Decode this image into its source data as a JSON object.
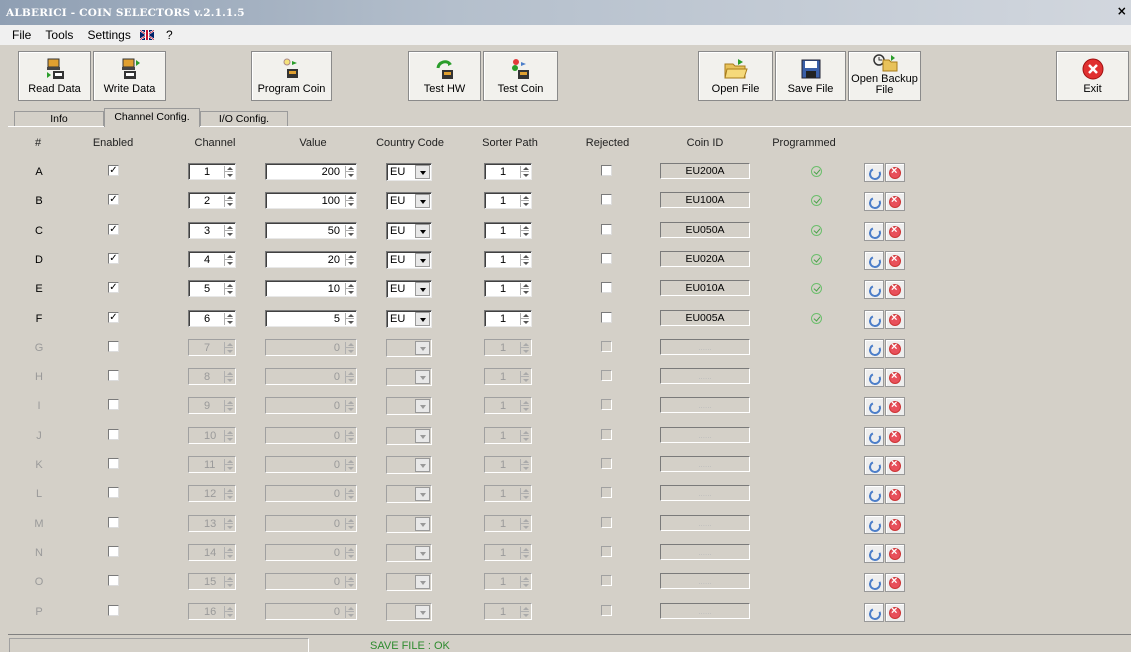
{
  "window": {
    "title": "ALBERICI - COIN SELECTORS v.2.1.1.5",
    "close_glyph": "×"
  },
  "menu": [
    "File",
    "Tools",
    "Settings",
    "?"
  ],
  "toolbar": {
    "read_data": "Read Data",
    "write_data": "Write Data",
    "program_coin": "Program Coin",
    "test_hw": "Test HW",
    "test_coin": "Test Coin",
    "open_file": "Open File",
    "save_file": "Save File",
    "open_backup_1": "Open Backup",
    "open_backup_2": "File",
    "exit": "Exit"
  },
  "tabs": [
    "Info",
    "Channel Config.",
    "I/O Config."
  ],
  "headers": {
    "num": "#",
    "enabled": "Enabled",
    "channel": "Channel",
    "value": "Value",
    "country": "Country Code",
    "sorter": "Sorter Path",
    "rejected": "Rejected",
    "coin_id": "Coin ID",
    "programmed": "Programmed"
  },
  "rows": [
    {
      "letter": "A",
      "enabled": true,
      "channel": "1",
      "value": "200",
      "country": "EU",
      "sorter": "1",
      "coin_id": "EU200A",
      "programmed": true
    },
    {
      "letter": "B",
      "enabled": true,
      "channel": "2",
      "value": "100",
      "country": "EU",
      "sorter": "1",
      "coin_id": "EU100A",
      "programmed": true
    },
    {
      "letter": "C",
      "enabled": true,
      "channel": "3",
      "value": "50",
      "country": "EU",
      "sorter": "1",
      "coin_id": "EU050A",
      "programmed": true
    },
    {
      "letter": "D",
      "enabled": true,
      "channel": "4",
      "value": "20",
      "country": "EU",
      "sorter": "1",
      "coin_id": "EU020A",
      "programmed": true
    },
    {
      "letter": "E",
      "enabled": true,
      "channel": "5",
      "value": "10",
      "country": "EU",
      "sorter": "1",
      "coin_id": "EU010A",
      "programmed": true
    },
    {
      "letter": "F",
      "enabled": true,
      "channel": "6",
      "value": "5",
      "country": "EU",
      "sorter": "1",
      "coin_id": "EU005A",
      "programmed": true
    },
    {
      "letter": "G",
      "enabled": false,
      "channel": "7",
      "value": "0",
      "country": "",
      "sorter": "1",
      "coin_id": "......",
      "programmed": false
    },
    {
      "letter": "H",
      "enabled": false,
      "channel": "8",
      "value": "0",
      "country": "",
      "sorter": "1",
      "coin_id": "......",
      "programmed": false
    },
    {
      "letter": "I",
      "enabled": false,
      "channel": "9",
      "value": "0",
      "country": "",
      "sorter": "1",
      "coin_id": "......",
      "programmed": false
    },
    {
      "letter": "J",
      "enabled": false,
      "channel": "10",
      "value": "0",
      "country": "",
      "sorter": "1",
      "coin_id": "......",
      "programmed": false
    },
    {
      "letter": "K",
      "enabled": false,
      "channel": "11",
      "value": "0",
      "country": "",
      "sorter": "1",
      "coin_id": "......",
      "programmed": false
    },
    {
      "letter": "L",
      "enabled": false,
      "channel": "12",
      "value": "0",
      "country": "",
      "sorter": "1",
      "coin_id": "......",
      "programmed": false
    },
    {
      "letter": "M",
      "enabled": false,
      "channel": "13",
      "value": "0",
      "country": "",
      "sorter": "1",
      "coin_id": "......",
      "programmed": false
    },
    {
      "letter": "N",
      "enabled": false,
      "channel": "14",
      "value": "0",
      "country": "",
      "sorter": "1",
      "coin_id": "......",
      "programmed": false
    },
    {
      "letter": "O",
      "enabled": false,
      "channel": "15",
      "value": "0",
      "country": "",
      "sorter": "1",
      "coin_id": "......",
      "programmed": false
    },
    {
      "letter": "P",
      "enabled": false,
      "channel": "16",
      "value": "0",
      "country": "",
      "sorter": "1",
      "coin_id": "......",
      "programmed": false
    }
  ],
  "status": {
    "message": "SAVE FILE : OK"
  }
}
